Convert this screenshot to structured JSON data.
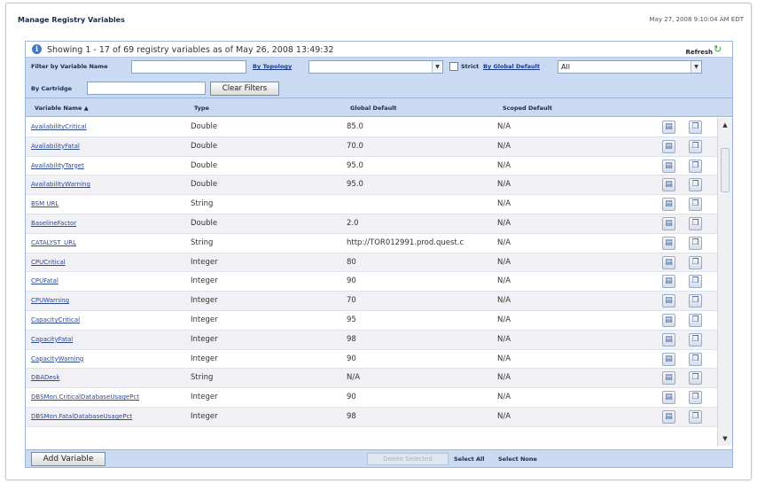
{
  "page": {
    "title": "Manage Registry Variables",
    "datetime": "May 27, 2008 9:10:04 AM EDT"
  },
  "status": {
    "text": "Showing 1 - 17 of 69 registry variables as of May 26, 2008 13:49:32",
    "refresh_label": "Refresh"
  },
  "filters": {
    "variable_name_label": "Filter by Variable Name",
    "variable_name_value": "",
    "topology_label": "By Topology",
    "topology_value": "",
    "strict_label": "Strict",
    "global_default_label": "By Global Default",
    "global_default_value": "All",
    "cartridge_label": "By Cartridge",
    "cartridge_value": "",
    "clear_label": "Clear Filters"
  },
  "table": {
    "columns": {
      "name": "Variable Name ▲",
      "type": "Type",
      "global": "Global Default",
      "scoped": "Scoped Default"
    },
    "rows": [
      {
        "name": "AvailabilityCritical",
        "type": "Double",
        "global": "85.0",
        "scoped": "N/A"
      },
      {
        "name": "AvailabilityFatal",
        "type": "Double",
        "global": "70.0",
        "scoped": "N/A"
      },
      {
        "name": "AvailabilityTarget",
        "type": "Double",
        "global": "95.0",
        "scoped": "N/A"
      },
      {
        "name": "AvailabilityWarning",
        "type": "Double",
        "global": "95.0",
        "scoped": "N/A"
      },
      {
        "name": "BSM URL",
        "type": "String",
        "global": "",
        "scoped": "N/A"
      },
      {
        "name": "BaselineFactor",
        "type": "Double",
        "global": "2.0",
        "scoped": "N/A"
      },
      {
        "name": "CATALYST_URL",
        "type": "String",
        "global": "http://TOR012991.prod.quest.c",
        "scoped": "N/A"
      },
      {
        "name": "CPUCritical",
        "type": "Integer",
        "global": "80",
        "scoped": "N/A"
      },
      {
        "name": "CPUFatal",
        "type": "Integer",
        "global": "90",
        "scoped": "N/A"
      },
      {
        "name": "CPUWarning",
        "type": "Integer",
        "global": "70",
        "scoped": "N/A"
      },
      {
        "name": "CapacityCritical",
        "type": "Integer",
        "global": "95",
        "scoped": "N/A"
      },
      {
        "name": "CapacityFatal",
        "type": "Integer",
        "global": "98",
        "scoped": "N/A"
      },
      {
        "name": "CapacityWarning",
        "type": "Integer",
        "global": "90",
        "scoped": "N/A"
      },
      {
        "name": "DBADesk",
        "type": "String",
        "global": "N/A",
        "scoped": "N/A"
      },
      {
        "name": "DBSMon.CriticalDatabaseUsagePct",
        "type": "Integer",
        "global": "90",
        "scoped": "N/A"
      },
      {
        "name": "DBSMon.FatalDatabaseUsagePct",
        "type": "Integer",
        "global": "98",
        "scoped": "N/A"
      }
    ]
  },
  "footer": {
    "add_label": "Add Variable",
    "delete_label": "Delete Selected",
    "select_all_label": "Select All",
    "select_none_label": "Select None"
  },
  "icons": {
    "info": "info-icon",
    "refresh": "refresh-icon",
    "edit": "edit-icon",
    "delete": "delete-icon",
    "dropdown": "chevron-down-icon"
  },
  "colors": {
    "header_blue": "#c9daf2",
    "link_blue": "#2b4a8f",
    "refresh_green": "#3c9a3c"
  }
}
